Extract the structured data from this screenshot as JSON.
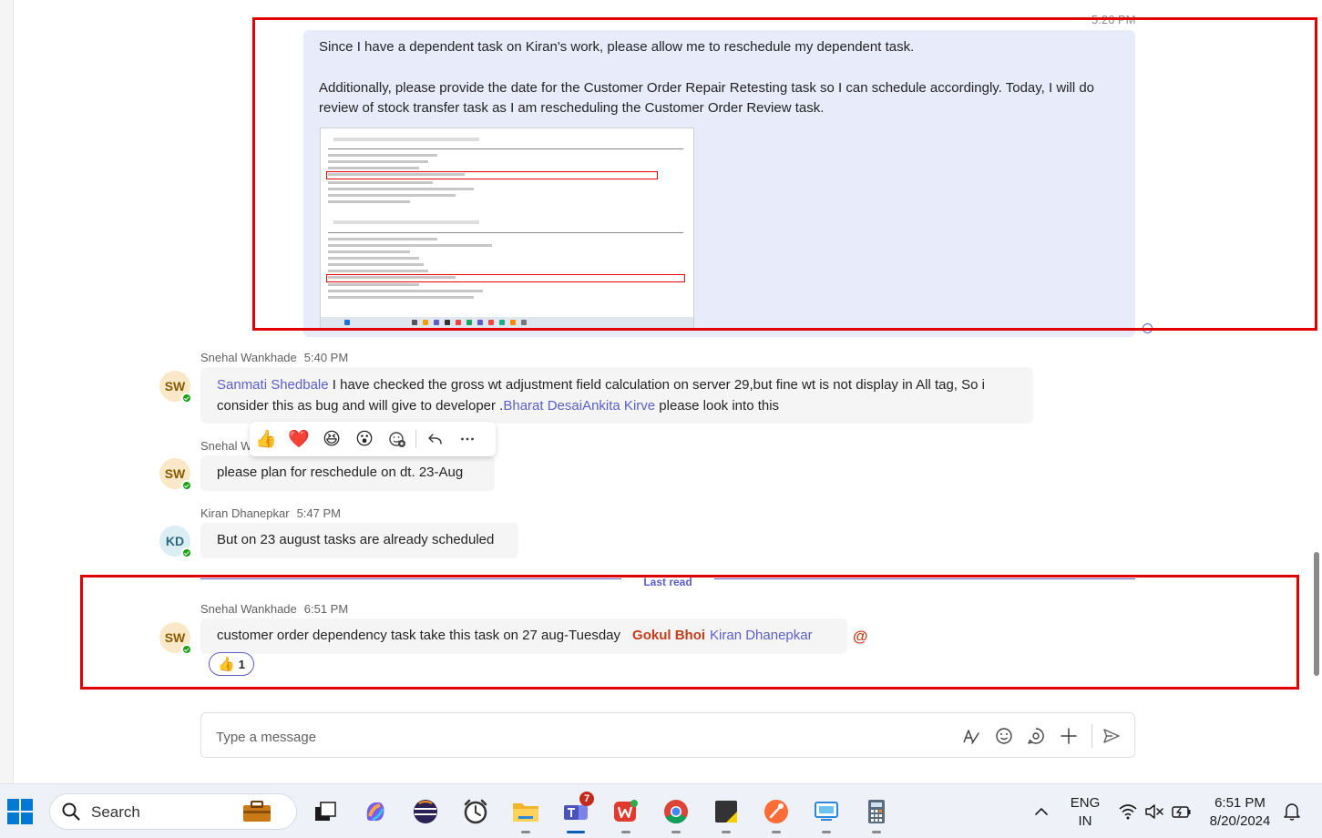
{
  "chat": {
    "top_message": {
      "time": "5:26 PM",
      "paragraph1": "Since I have a dependent task on Kiran's work, please allow me to reschedule my dependent task.",
      "paragraph2": "Additionally, please provide the date for the Customer Order Repair Retesting task so I can schedule accordingly. Today, I will do review of  stock transfer task as I am rescheduling the Customer Order Review task."
    },
    "messages": [
      {
        "author": "Snehal Wankhade",
        "initials": "SW",
        "time": "5:40 PM",
        "mention1": "Sanmati Shedbale",
        "text1": " I have checked the gross wt adjustment field calculation on server 29,but fine wt is not display in All tag, So i consider this as bug and will give to developer .",
        "mention2": "Bharat Desai",
        "mention3": "Ankita Kirve",
        "text2": " please look into this"
      },
      {
        "author": "Snehal W",
        "initials": "SW",
        "time": "",
        "text": "please plan for reschedule on dt. 23-Aug"
      },
      {
        "author": "Kiran Dhanepkar",
        "initials": "KD",
        "time": "5:47 PM",
        "text": "But on 23 august tasks are already scheduled"
      },
      {
        "author": "Snehal Wankhade",
        "initials": "SW",
        "time": "6:51 PM",
        "text": "customer order dependency task take this task on 27 aug-Tuesday",
        "mention_me": "Gokul Bhoi",
        "mention": "Kiran Dhanepkar",
        "reaction_count": "1"
      }
    ],
    "last_read_label": "Last read",
    "at_symbol": "@"
  },
  "reactions": [
    "👍",
    "❤️",
    "😆",
    "😮"
  ],
  "composer": {
    "placeholder": "Type a message"
  },
  "taskbar": {
    "search_placeholder": "Search",
    "teams_badge": "7",
    "language_line1": "ENG",
    "language_line2": "IN",
    "clock_time": "6:51 PM",
    "clock_date": "8/20/2024"
  },
  "colors": {
    "accent": "#5b5fc7",
    "my_bubble": "#e8ebfa",
    "highlight_box": "#e00000",
    "mention_me": "#c43e1c"
  }
}
